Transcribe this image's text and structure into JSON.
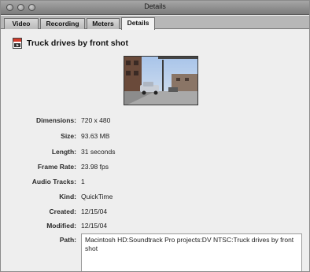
{
  "window": {
    "title": "Details"
  },
  "tabs": [
    {
      "label": "Video"
    },
    {
      "label": "Recording"
    },
    {
      "label": "Meters"
    },
    {
      "label": "Details",
      "active": true
    }
  ],
  "file": {
    "name": "Truck drives by front shot",
    "icon": "quicktime-movie-icon"
  },
  "details": [
    {
      "label": "Dimensions:",
      "value": "720 x 480"
    },
    {
      "label": "Size:",
      "value": "93.63 MB"
    },
    {
      "label": "Length:",
      "value": "31 seconds"
    },
    {
      "label": "Frame Rate:",
      "value": "23.98 fps"
    },
    {
      "label": "Audio Tracks:",
      "value": "1"
    },
    {
      "label": "Kind:",
      "value": "QuickTime"
    },
    {
      "label": "Created:",
      "value": "12/15/04"
    },
    {
      "label": "Modified:",
      "value": "12/15/04"
    }
  ],
  "path": {
    "label": "Path:",
    "value": "Macintosh HD:Soundtrack Pro projects:DV NTSC:Truck drives by front shot"
  }
}
